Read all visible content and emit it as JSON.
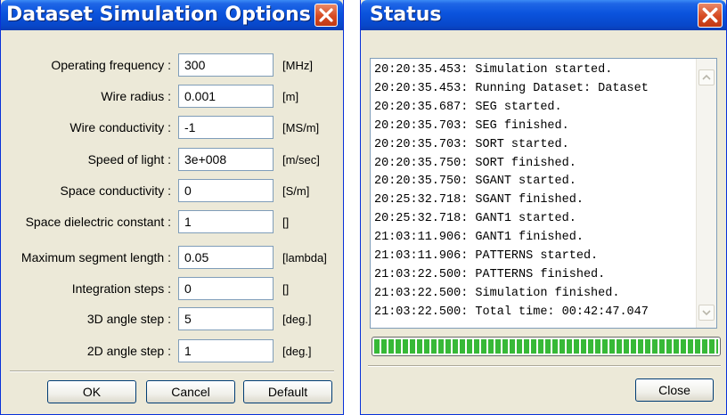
{
  "options_dialog": {
    "title": "Dataset Simulation Options",
    "fields": [
      {
        "label": "Operating frequency :",
        "value": "300",
        "unit": "[MHz]"
      },
      {
        "label": "Wire radius :",
        "value": "0.001",
        "unit": "[m]"
      },
      {
        "label": "Wire conductivity :",
        "value": "-1",
        "unit": "[MS/m]"
      },
      {
        "label": "Speed of light :",
        "value": "3e+008",
        "unit": "[m/sec]"
      },
      {
        "label": "Space conductivity :",
        "value": "0",
        "unit": "[S/m]"
      },
      {
        "label": "Space dielectric constant :",
        "value": "1",
        "unit": "[]"
      },
      {
        "label": "Maximum segment length :",
        "value": "0.05",
        "unit": "[lambda]"
      },
      {
        "label": "Integration steps :",
        "value": "0",
        "unit": "[]"
      },
      {
        "label": "3D angle step :",
        "value": "5",
        "unit": "[deg.]"
      },
      {
        "label": "2D angle step :",
        "value": "1",
        "unit": "[deg.]"
      }
    ],
    "buttons": {
      "ok": "OK",
      "cancel": "Cancel",
      "default": "Default"
    }
  },
  "status_dialog": {
    "title": "Status",
    "log": [
      "20:20:35.453: Simulation started.",
      "20:20:35.453: Running Dataset: Dataset",
      "20:20:35.687: SEG started.",
      "20:20:35.703: SEG finished.",
      "20:20:35.703: SORT started.",
      "20:20:35.750: SORT finished.",
      "20:20:35.750: SGANT started.",
      "20:25:32.718: SGANT finished.",
      "20:25:32.718: GANT1 started.",
      "21:03:11.906: GANT1 finished.",
      "21:03:11.906: PATTERNS started.",
      "21:03:22.500: PATTERNS finished.",
      "21:03:22.500: Simulation finished.",
      "21:03:22.500: Total time: 00:42:47.047"
    ],
    "progress_percent": 100,
    "close_label": "Close"
  },
  "icons": {
    "close": "close-icon",
    "scroll_up": "scroll-up-icon",
    "scroll_down": "scroll-down-icon"
  }
}
